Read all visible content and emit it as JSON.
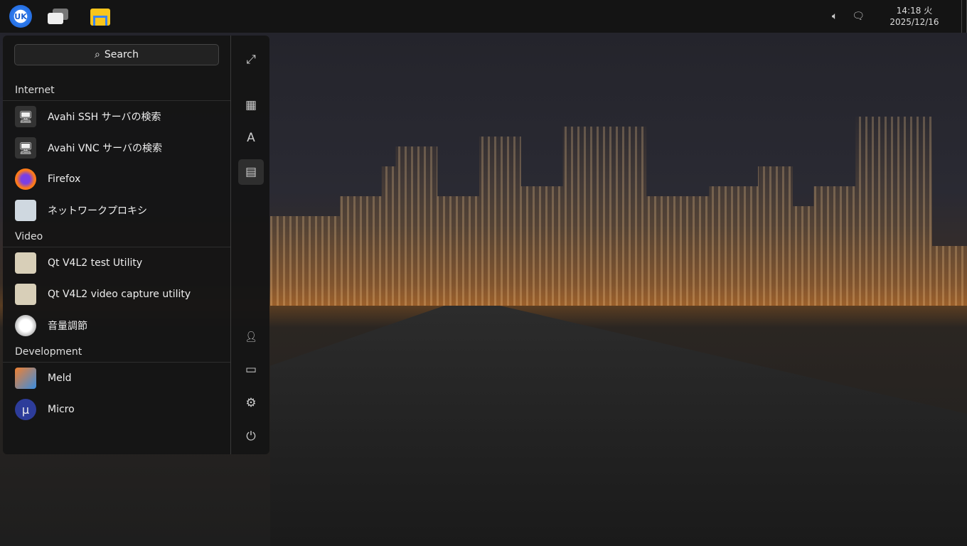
{
  "taskbar": {
    "start_logo": "UK",
    "clock_time": "14:18 火",
    "clock_date": "2025/12/16",
    "volume_icon": "speaker-icon",
    "notification_icon": "message-icon"
  },
  "menu": {
    "search_label": "Search",
    "categories": [
      {
        "name": "Internet",
        "items": [
          {
            "label": "Avahi SSH サーバの検索",
            "icon": "network-monitor-icon"
          },
          {
            "label": "Avahi VNC サーバの検索",
            "icon": "network-monitor-icon"
          },
          {
            "label": "Firefox",
            "icon": "firefox-icon"
          },
          {
            "label": "ネットワークプロキシ",
            "icon": "proxy-icon"
          }
        ]
      },
      {
        "name": "Video",
        "items": [
          {
            "label": "Qt V4L2 test Utility",
            "icon": "qt-v4l2-icon"
          },
          {
            "label": "Qt V4L2 video capture utility",
            "icon": "qt-v4l2-icon"
          },
          {
            "label": "音量調節",
            "icon": "volume-control-icon"
          }
        ]
      },
      {
        "name": "Development",
        "items": [
          {
            "label": "Meld",
            "icon": "meld-icon"
          },
          {
            "label": "Micro",
            "icon": "micro-icon"
          }
        ]
      }
    ],
    "side_buttons": [
      "expand",
      "category-view",
      "letter-view",
      "function-view",
      "user",
      "computer",
      "settings",
      "power"
    ]
  }
}
